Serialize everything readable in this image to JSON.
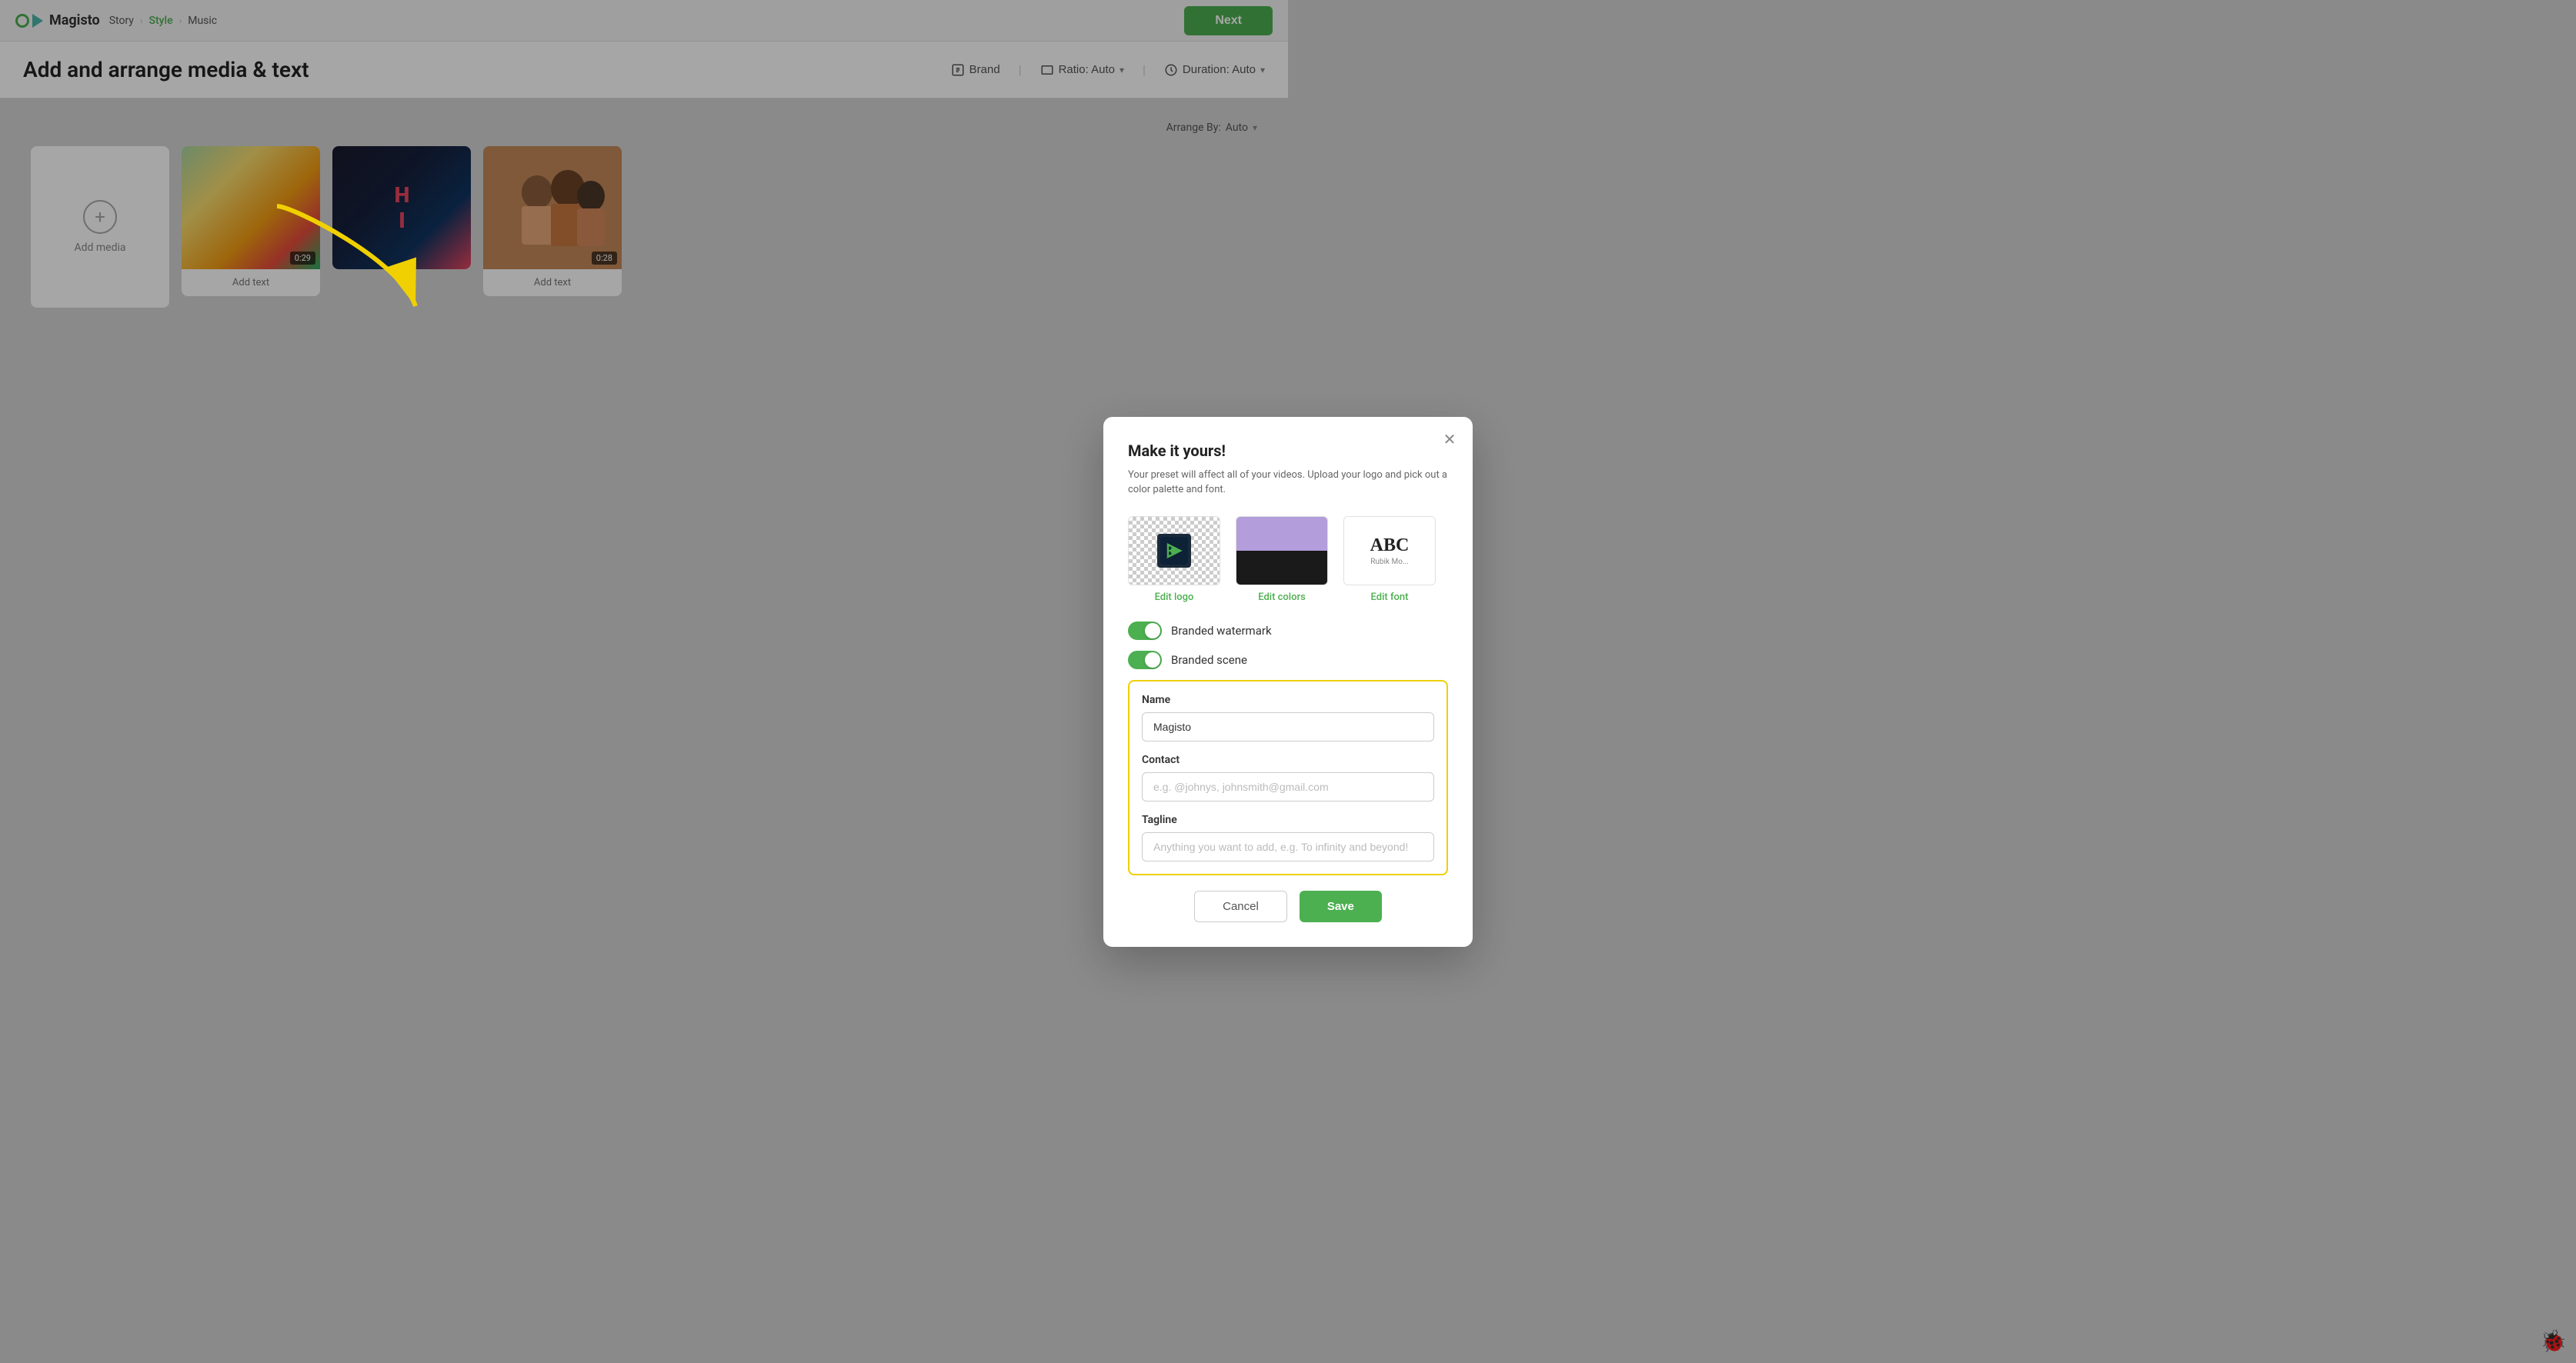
{
  "app": {
    "name": "Magisto"
  },
  "nav": {
    "breadcrumbs": [
      {
        "label": "Story",
        "active": false
      },
      {
        "label": "Style",
        "active": true
      },
      {
        "label": "Music",
        "active": false
      }
    ],
    "next_button": "Next"
  },
  "page": {
    "title": "Add and arrange media & text",
    "brand_label": "Brand",
    "ratio_label": "Ratio: Auto",
    "duration_label": "Duration: Auto",
    "arrange_label": "Arrange By:",
    "arrange_value": "Auto"
  },
  "media_items": [
    {
      "type": "add",
      "label": "Add media"
    },
    {
      "type": "thumb",
      "style": "balloon",
      "badge": "0:29",
      "text_label": "Add text"
    },
    {
      "type": "thumb",
      "style": "dark",
      "badge": ""
    },
    {
      "type": "thumb",
      "style": "family",
      "badge": "0:28",
      "text_label": "Add text"
    }
  ],
  "modal": {
    "title": "Make it yours!",
    "description": "Your preset will affect all of your videos. Upload your logo and pick out a color palette and font.",
    "edit_logo_label": "Edit logo",
    "edit_colors_label": "Edit colors",
    "edit_font_label": "Edit font",
    "font_abc": "ABC",
    "font_name": "Rubik Mo...",
    "branded_watermark_label": "Branded watermark",
    "branded_scene_label": "Branded scene",
    "form_section": {
      "name_label": "Name",
      "name_value": "Magisto",
      "contact_label": "Contact",
      "contact_placeholder": "e.g. @johnys, johnsmith@gmail.com",
      "tagline_label": "Tagline",
      "tagline_placeholder": "Anything you want to add, e.g. To infinity and beyond!"
    },
    "cancel_label": "Cancel",
    "save_label": "Save"
  }
}
